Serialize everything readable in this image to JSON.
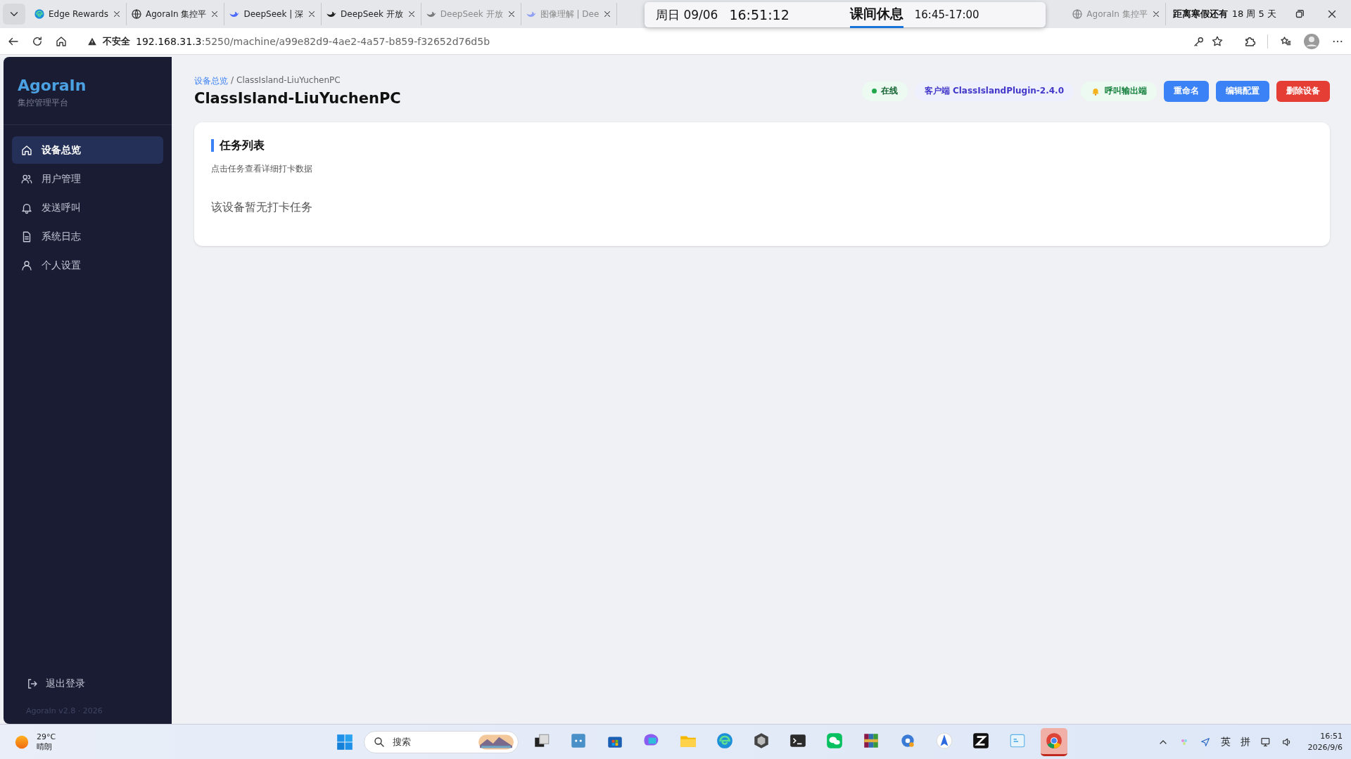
{
  "browser": {
    "tabs": [
      {
        "title": "Edge Rewards",
        "sleeping": false
      },
      {
        "title": "AgoraIn 集控平",
        "sleeping": false
      },
      {
        "title": "DeepSeek | 深",
        "sleeping": false
      },
      {
        "title": "DeepSeek 开放",
        "sleeping": false
      },
      {
        "title": "DeepSeek 开放",
        "sleeping": true
      },
      {
        "title": "图像理解 | Dee",
        "sleeping": true
      },
      {
        "title": "AgoraIn 集控平",
        "sleeping": true
      }
    ],
    "security": "不安全",
    "url_host": "192.168.31.3",
    "url_rest": ":5250/machine/a99e82d9-4ae2-4a57-b859-f32652d76d5b"
  },
  "overlay": {
    "date": "周日 09/06",
    "time": "16:51:12",
    "period": "课间休息",
    "period_time": "16:45-17:00",
    "countdown_label": "距离寒假还有",
    "countdown_value": "18 周 5 天"
  },
  "sidebar": {
    "brand": "AgoraIn",
    "subtitle": "集控管理平台",
    "items": [
      {
        "label": "设备总览",
        "selected": true
      },
      {
        "label": "用户管理",
        "selected": false
      },
      {
        "label": "发送呼叫",
        "selected": false
      },
      {
        "label": "系统日志",
        "selected": false
      },
      {
        "label": "个人设置",
        "selected": false
      }
    ],
    "logout": "退出登录",
    "version": "AgoraIn v2.8 · 2026"
  },
  "header": {
    "breadcrumb": "设备总览",
    "breadcrumb_separator": "/",
    "breadcrumb_current": "ClassIsland-LiuYuchenPC",
    "title": "ClassIsland-LiuYuchenPC",
    "badges": [
      {
        "kind": "status",
        "text": "在线",
        "color": "#22a84a"
      },
      {
        "kind": "client",
        "text": "客户端 ClassIslandPlugin-2.4.0"
      },
      {
        "kind": "call",
        "text": "呼叫输出端"
      }
    ],
    "buttons": [
      {
        "label": "重命名",
        "kind": "primary"
      },
      {
        "label": "编辑配置",
        "kind": "primary"
      },
      {
        "label": "删除设备",
        "kind": "danger"
      }
    ]
  },
  "card": {
    "title": "任务列表",
    "hint": "点击任务查看详细打卡数据",
    "empty": "该设备暂无打卡任务"
  },
  "taskbar": {
    "temp": "29°C",
    "weather": "晴朗",
    "search": "搜索",
    "apps": [
      {
        "active": false
      },
      {
        "active": false
      },
      {
        "active": false
      },
      {
        "active": false
      },
      {
        "active": false
      },
      {
        "active": false
      },
      {
        "active": false
      },
      {
        "active": false
      },
      {
        "active": false
      },
      {
        "active": false
      },
      {
        "active": false
      },
      {
        "active": false
      },
      {
        "active": false
      },
      {
        "active": false
      },
      {
        "active": true
      }
    ],
    "ime1": "英",
    "ime2": "拼",
    "time": "16:51",
    "date": "2026/9/6"
  }
}
